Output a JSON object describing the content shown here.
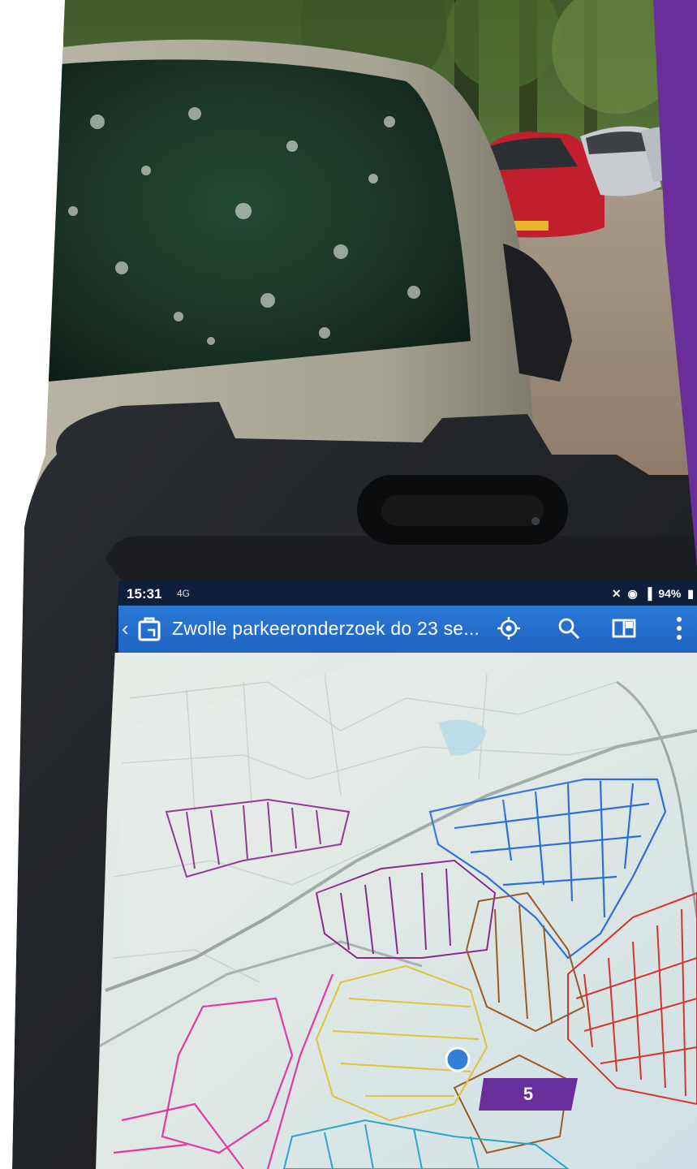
{
  "status_bar": {
    "time": "15:31",
    "network": "4G",
    "battery": "94%",
    "icons": [
      "mute-icon",
      "location-icon",
      "data-icon",
      "signal-icon",
      "battery-icon"
    ]
  },
  "app_bar": {
    "title": "Zwolle parkeeronderzoek do 23 se...",
    "icons": [
      "back-icon",
      "map-icon",
      "locate-icon",
      "search-icon",
      "layers-icon",
      "more-icon"
    ]
  },
  "map": {
    "district_colors": [
      "#8b2a8b",
      "#2d6fd6",
      "#9a5a2a",
      "#d6342f",
      "#e0c23a",
      "#e03aa0",
      "#2aa6c8"
    ]
  },
  "slide": {
    "page_number": "5",
    "accent_color": "#6a2e9a"
  }
}
